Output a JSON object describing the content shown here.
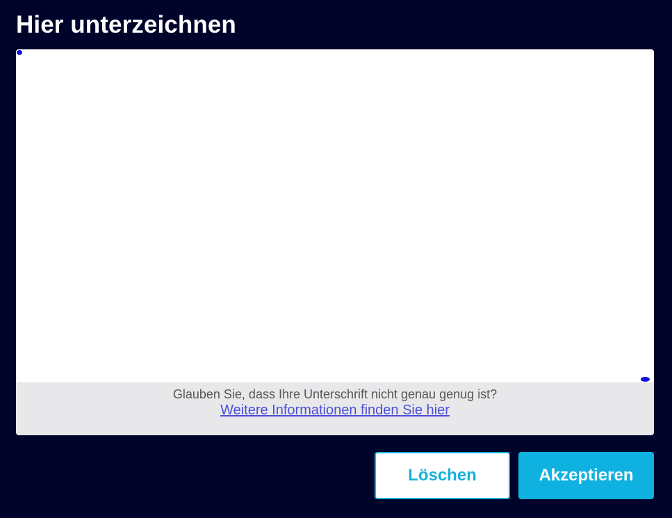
{
  "dialog": {
    "title": "Hier unterzeichnen"
  },
  "signature_pad": {
    "help_text": "Glauben Sie, dass Ihre Unterschrift nicht genau genug ist?",
    "help_link": "Weitere Informationen finden Sie hier",
    "stroke_color": "#1010e0"
  },
  "actions": {
    "clear_label": "Löschen",
    "accept_label": "Akzeptieren"
  },
  "colors": {
    "background": "#00032a",
    "accent": "#0fb1e1",
    "link": "#4a4fd6"
  }
}
